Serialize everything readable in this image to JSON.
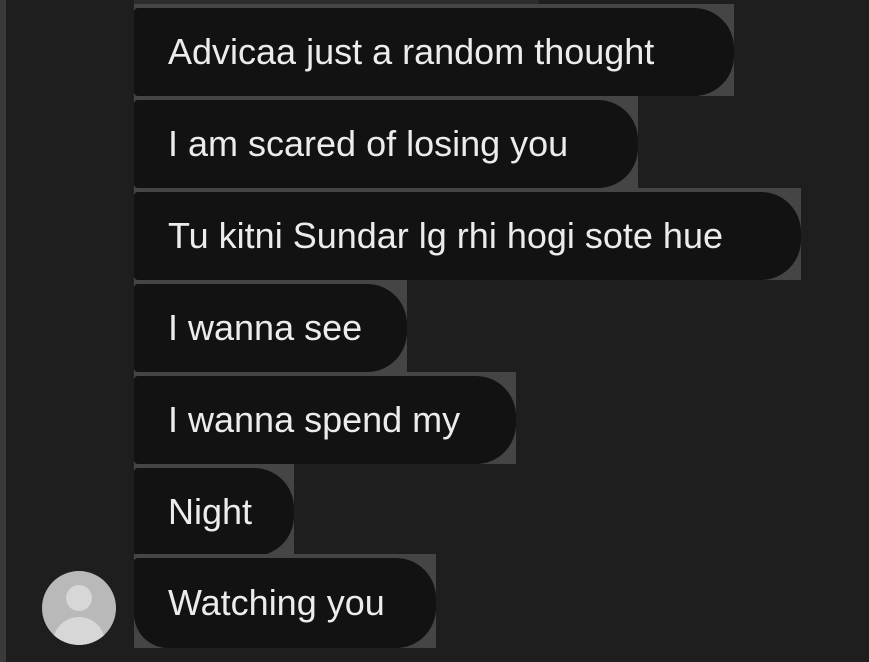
{
  "chat": {
    "messages": [
      {
        "text": "Advicaa just a random thought"
      },
      {
        "text": "I am scared of losing you"
      },
      {
        "text": "Tu kitni Sundar lg rhi hogi sote hue"
      },
      {
        "text": "I wanna see"
      },
      {
        "text": "I wanna spend my"
      },
      {
        "text": "Night"
      },
      {
        "text": "Watching you"
      }
    ],
    "sender_avatar": "default-user-avatar-icon"
  },
  "colors": {
    "background": "#1e1e1e",
    "bubble": "#121212",
    "bubble_outline": "#454545",
    "text": "#ececec",
    "avatar": "#b9b9b9"
  }
}
